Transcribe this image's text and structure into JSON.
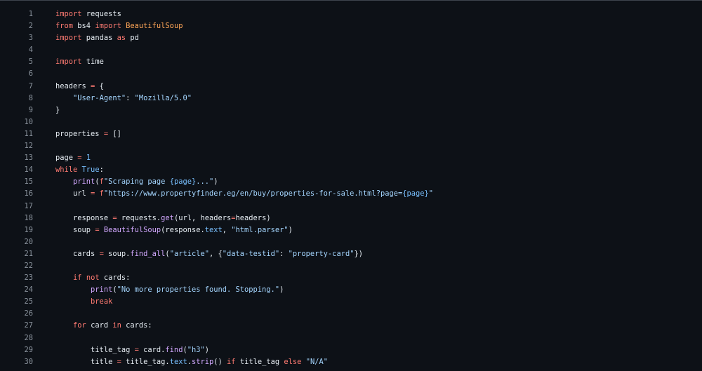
{
  "theme": {
    "background": "#0d1117",
    "line_number_color": "#8b949e",
    "keyword_color": "#ff7b72",
    "function_color": "#d2a8ff",
    "string_color": "#a5d6ff",
    "class_color": "#ffa657",
    "constant_color": "#79c0ff",
    "text_color": "#e6edf3"
  },
  "code_lines": [
    {
      "n": "1",
      "tokens": [
        [
          "kw",
          "import"
        ],
        [
          "pl",
          " requests"
        ]
      ]
    },
    {
      "n": "2",
      "tokens": [
        [
          "kw",
          "from"
        ],
        [
          "pl",
          " bs4 "
        ],
        [
          "kw",
          "import"
        ],
        [
          "pl",
          " "
        ],
        [
          "cl",
          "BeautifulSoup"
        ]
      ]
    },
    {
      "n": "3",
      "tokens": [
        [
          "kw",
          "import"
        ],
        [
          "pl",
          " pandas "
        ],
        [
          "kw",
          "as"
        ],
        [
          "pl",
          " pd"
        ]
      ]
    },
    {
      "n": "4",
      "tokens": []
    },
    {
      "n": "5",
      "tokens": [
        [
          "kw",
          "import"
        ],
        [
          "pl",
          " time"
        ]
      ]
    },
    {
      "n": "6",
      "tokens": []
    },
    {
      "n": "7",
      "tokens": [
        [
          "pl",
          "headers "
        ],
        [
          "kw",
          "="
        ],
        [
          "pl",
          " {"
        ]
      ]
    },
    {
      "n": "8",
      "tokens": [
        [
          "pl",
          "    "
        ],
        [
          "st",
          "\"User-Agent\""
        ],
        [
          "pl",
          ": "
        ],
        [
          "st",
          "\"Mozilla/5.0\""
        ]
      ]
    },
    {
      "n": "9",
      "tokens": [
        [
          "pl",
          "}"
        ]
      ]
    },
    {
      "n": "10",
      "tokens": []
    },
    {
      "n": "11",
      "tokens": [
        [
          "pl",
          "properties "
        ],
        [
          "kw",
          "="
        ],
        [
          "pl",
          " []"
        ]
      ]
    },
    {
      "n": "12",
      "tokens": []
    },
    {
      "n": "13",
      "tokens": [
        [
          "pl",
          "page "
        ],
        [
          "kw",
          "="
        ],
        [
          "pl",
          " "
        ],
        [
          "cn",
          "1"
        ]
      ]
    },
    {
      "n": "14",
      "tokens": [
        [
          "kw",
          "while"
        ],
        [
          "pl",
          " "
        ],
        [
          "cn",
          "True"
        ],
        [
          "pl",
          ":"
        ]
      ]
    },
    {
      "n": "15",
      "tokens": [
        [
          "pl",
          "    "
        ],
        [
          "fn",
          "print"
        ],
        [
          "pl",
          "("
        ],
        [
          "kw",
          "f"
        ],
        [
          "st",
          "\"Scraping page "
        ],
        [
          "cn",
          "{page}"
        ],
        [
          "st",
          "...\""
        ],
        [
          "pl",
          ")"
        ]
      ]
    },
    {
      "n": "16",
      "tokens": [
        [
          "pl",
          "    url "
        ],
        [
          "kw",
          "="
        ],
        [
          "pl",
          " "
        ],
        [
          "kw",
          "f"
        ],
        [
          "st",
          "\"https://www.propertyfinder.eg/en/buy/properties-for-sale.html?page="
        ],
        [
          "cn",
          "{page}"
        ],
        [
          "st",
          "\""
        ]
      ]
    },
    {
      "n": "17",
      "tokens": []
    },
    {
      "n": "18",
      "tokens": [
        [
          "pl",
          "    response "
        ],
        [
          "kw",
          "="
        ],
        [
          "pl",
          " requests."
        ],
        [
          "fn",
          "get"
        ],
        [
          "pl",
          "(url, headers"
        ],
        [
          "kw",
          "="
        ],
        [
          "pl",
          "headers)"
        ]
      ]
    },
    {
      "n": "19",
      "tokens": [
        [
          "pl",
          "    soup "
        ],
        [
          "kw",
          "="
        ],
        [
          "pl",
          " "
        ],
        [
          "fn",
          "BeautifulSoup"
        ],
        [
          "pl",
          "(response."
        ],
        [
          "cn",
          "text"
        ],
        [
          "pl",
          ", "
        ],
        [
          "st",
          "\"html.parser\""
        ],
        [
          "pl",
          ")"
        ]
      ]
    },
    {
      "n": "20",
      "tokens": []
    },
    {
      "n": "21",
      "tokens": [
        [
          "pl",
          "    cards "
        ],
        [
          "kw",
          "="
        ],
        [
          "pl",
          " soup."
        ],
        [
          "fn",
          "find_all"
        ],
        [
          "pl",
          "("
        ],
        [
          "st",
          "\"article\""
        ],
        [
          "pl",
          ", {"
        ],
        [
          "st",
          "\"data-testid\""
        ],
        [
          "pl",
          ": "
        ],
        [
          "st",
          "\"property-card\""
        ],
        [
          "pl",
          "})"
        ]
      ]
    },
    {
      "n": "22",
      "tokens": []
    },
    {
      "n": "23",
      "tokens": [
        [
          "pl",
          "    "
        ],
        [
          "kw",
          "if"
        ],
        [
          "pl",
          " "
        ],
        [
          "kw",
          "not"
        ],
        [
          "pl",
          " cards:"
        ]
      ]
    },
    {
      "n": "24",
      "tokens": [
        [
          "pl",
          "        "
        ],
        [
          "fn",
          "print"
        ],
        [
          "pl",
          "("
        ],
        [
          "st",
          "\"No more properties found. Stopping.\""
        ],
        [
          "pl",
          ")"
        ]
      ]
    },
    {
      "n": "25",
      "tokens": [
        [
          "pl",
          "        "
        ],
        [
          "kw",
          "break"
        ]
      ]
    },
    {
      "n": "26",
      "tokens": []
    },
    {
      "n": "27",
      "tokens": [
        [
          "pl",
          "    "
        ],
        [
          "kw",
          "for"
        ],
        [
          "pl",
          " card "
        ],
        [
          "kw",
          "in"
        ],
        [
          "pl",
          " cards:"
        ]
      ]
    },
    {
      "n": "28",
      "tokens": []
    },
    {
      "n": "29",
      "tokens": [
        [
          "pl",
          "        title_tag "
        ],
        [
          "kw",
          "="
        ],
        [
          "pl",
          " card."
        ],
        [
          "fn",
          "find"
        ],
        [
          "pl",
          "("
        ],
        [
          "st",
          "\"h3\""
        ],
        [
          "pl",
          ")"
        ]
      ]
    },
    {
      "n": "30",
      "tokens": [
        [
          "pl",
          "        title "
        ],
        [
          "kw",
          "="
        ],
        [
          "pl",
          " title_tag."
        ],
        [
          "cn",
          "text"
        ],
        [
          "pl",
          "."
        ],
        [
          "fn",
          "strip"
        ],
        [
          "pl",
          "() "
        ],
        [
          "kw",
          "if"
        ],
        [
          "pl",
          " title_tag "
        ],
        [
          "kw",
          "else"
        ],
        [
          "pl",
          " "
        ],
        [
          "st",
          "\"N/A\""
        ]
      ]
    }
  ]
}
